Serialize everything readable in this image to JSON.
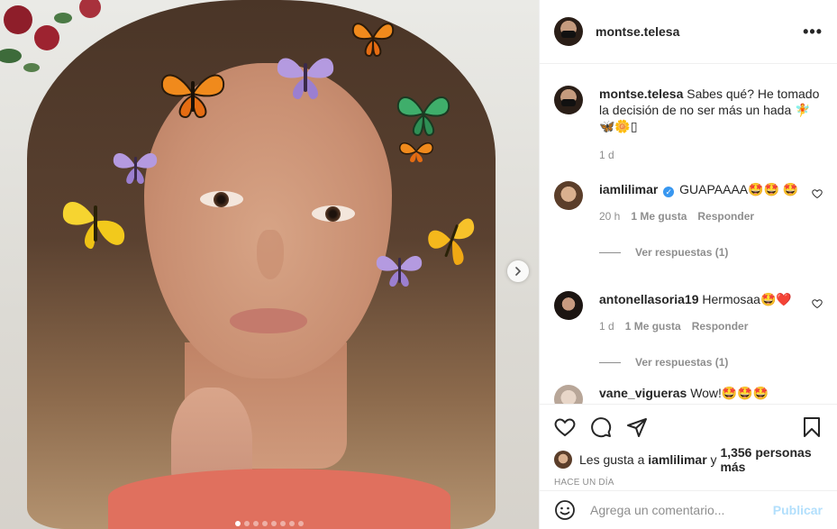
{
  "post": {
    "author": "montse.telesa",
    "more_label": "•••"
  },
  "caption": {
    "username": "montse.telesa",
    "text": "Sabes qué? He tomado la decisión de no ser más un hada 🧚 🦋🌼▯",
    "time": "1 d"
  },
  "comments": [
    {
      "username": "iamlilimar",
      "verified": true,
      "text": "GUAPAAAA🤩🤩 🤩",
      "time": "20 h",
      "likes": "1 Me gusta",
      "reply_label": "Responder",
      "view_replies": "Ver respuestas (1)"
    },
    {
      "username": "antonellasoria19",
      "verified": false,
      "text": "Hermosaa🤩❤️",
      "time": "1 d",
      "likes": "1 Me gusta",
      "reply_label": "Responder",
      "view_replies": "Ver respuestas (1)"
    },
    {
      "username": "vane_vigueras",
      "verified": false,
      "text": "Wow!🤩🤩🤩"
    }
  ],
  "actions": {
    "like_icon": "heart-icon",
    "comment_icon": "comment-icon",
    "share_icon": "paper-plane-icon",
    "save_icon": "bookmark-icon"
  },
  "likes": {
    "prefix": "Les gusta a ",
    "user": "iamlilimar",
    "middle": " y ",
    "count": "1,356 personas más"
  },
  "timestamp": "Hace un día",
  "composer": {
    "emoji_icon": "smiley-icon",
    "placeholder": "Agrega un comentario...",
    "publish_label": "Publicar"
  },
  "carousel": {
    "total": 8,
    "active_index": 0
  },
  "colors": {
    "text": "#262626",
    "secondary": "#8e8e8e",
    "verified": "#3897f0",
    "publish_disabled": "#b2dffc"
  }
}
